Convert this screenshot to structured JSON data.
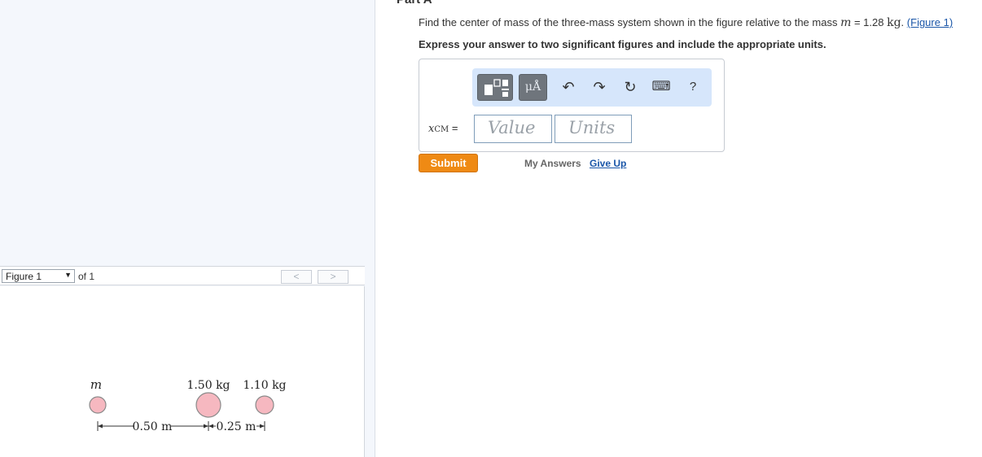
{
  "left_panel": {
    "figure_select": "Figure 1",
    "of_text": "of 1",
    "prev_label": "<",
    "next_label": ">",
    "figure": {
      "mass_labels": [
        "m",
        "1.50 kg",
        "1.10 kg"
      ],
      "dist_labels": [
        "0.50 m",
        "0.25 m"
      ]
    }
  },
  "question": {
    "part_title": "Part A",
    "text_prefix": "Find the center of mass of the three-mass system shown in the figure relative to the mass",
    "m_symbol": "m",
    "equals": " = 1.28 ",
    "unit": "kg",
    "period": ".",
    "figure_link": "(Figure 1)",
    "instruction": "Express your answer to two significant figures and include the appropriate units."
  },
  "answer": {
    "toolbar": {
      "mu_label": "μÅ",
      "undo_icon": "↶",
      "redo_icon": "↷",
      "reset_icon": "↻",
      "keyboard_icon": "⌨",
      "help_label": "?"
    },
    "xcm_symbol": "x",
    "xcm_sub": "CM",
    "xcm_eq": " =",
    "value_placeholder": "Value",
    "units_placeholder": "Units"
  },
  "actions": {
    "submit": "Submit",
    "my_answers": "My Answers",
    "give_up": "Give Up"
  },
  "colors": {
    "submit_bg": "#ef8a14",
    "link": "#1a56a8",
    "toolbar_bg": "#d6e6fb",
    "sphere_fill": "#f6b8c0"
  }
}
